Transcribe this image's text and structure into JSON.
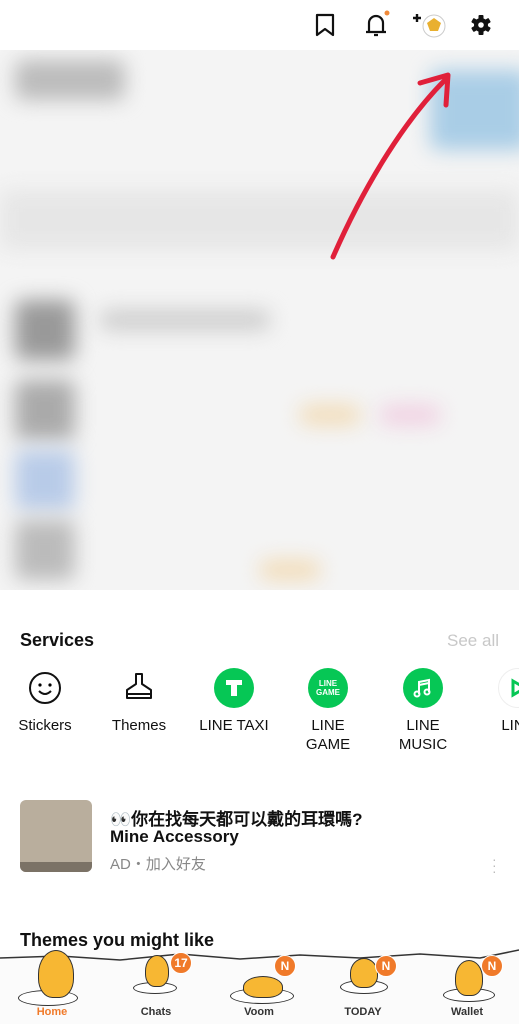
{
  "header": {
    "icons": [
      "bookmark-icon",
      "bell-icon",
      "add-profile-icon",
      "gear-icon"
    ],
    "notification_dot_color": "#f08a3a"
  },
  "annotation": {
    "arrow_color": "#e0203a"
  },
  "services": {
    "title": "Services",
    "see_all": "See all",
    "items": [
      {
        "label": "Stickers",
        "icon": "smiley-icon"
      },
      {
        "label": "Themes",
        "icon": "brush-icon"
      },
      {
        "label": "LINE TAXI",
        "icon": "taxi-icon"
      },
      {
        "label": "LINE\nGAME",
        "icon": "game-icon",
        "icon_text": "LINE\nGAME"
      },
      {
        "label": "LINE\nMUSIC",
        "icon": "music-icon"
      },
      {
        "label": "LINE",
        "icon": "play-icon"
      }
    ],
    "accent": "#06c755"
  },
  "ad": {
    "title": "👀你在找每天都可以戴的耳環嗎?",
    "subtitle": "Mine Accessory",
    "meta": "AD・加入好友"
  },
  "themes": {
    "title": "Themes you might like"
  },
  "tabs": [
    {
      "label": "Home",
      "active": true
    },
    {
      "label": "Chats",
      "badge": "17"
    },
    {
      "label": "Voom",
      "badge": "N"
    },
    {
      "label": "TODAY",
      "badge": "N"
    },
    {
      "label": "Wallet",
      "badge": "N"
    }
  ],
  "tab_active_color": "#f07a2a"
}
